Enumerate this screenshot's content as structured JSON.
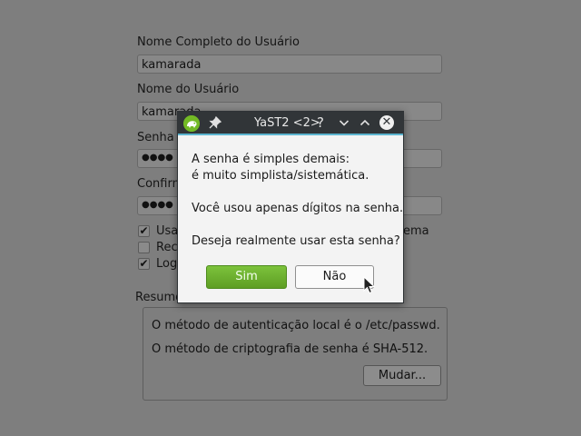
{
  "background_form": {
    "full_name_label": "Nome Completo do Usuário",
    "full_name_value": "kamarada",
    "username_label": "Nome do Usuário",
    "username_value": "kamarada",
    "password_label": "Senha",
    "password_value": "●●●●",
    "confirm_label": "Confirm",
    "confirm_value": "●●●●",
    "checkboxes": [
      {
        "label": "Usa",
        "checked": true,
        "checkmark": "✔"
      },
      {
        "label": "Rec",
        "checked": false,
        "checkmark": ""
      },
      {
        "label": "Log",
        "checked": true,
        "checkmark": "✔"
      }
    ],
    "trailing_text": "ema",
    "summary_label": "Resumo",
    "summary_lines": [
      "O método de autenticação local é o /etc/passwd.",
      "O método de criptografia de senha é SHA-512."
    ],
    "change_button": "Mudar..."
  },
  "dialog": {
    "title": "YaST2 <2>",
    "icons": {
      "app": "opensuse-chameleon-icon",
      "pin": "pin-icon",
      "help": "?",
      "minimize": "chevron-down-icon",
      "maximize": "chevron-up-icon",
      "close": "close-icon"
    },
    "icon_glyphs": {
      "pin": "📌",
      "help": "?",
      "minimize": "⌄",
      "maximize": "⌃",
      "close": "✕"
    },
    "message_line1": "A senha é simples demais:",
    "message_line2": "é muito simplista/sistemática.",
    "message_line3": "Você usou apenas dígitos na senha.",
    "message_line4": "Deseja realmente usar esta senha?",
    "yes_button": "Sim",
    "no_button": "Não"
  },
  "colors": {
    "accent": "#5bb5d0",
    "primary_button": "#73ba25",
    "titlebar": "#313538",
    "dimmed_background": "#7e7e7e"
  }
}
